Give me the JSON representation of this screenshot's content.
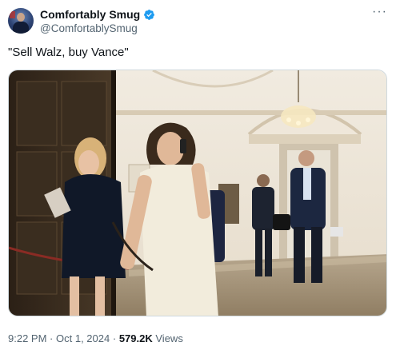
{
  "tweet": {
    "author": {
      "display_name": "Comfortably Smug",
      "handle": "@ComfortablySmug",
      "verified": true,
      "avatar_icon": "profile-avatar"
    },
    "more_icon": "more-horizontal-icon",
    "text": "\"Sell Walz, buy Vance\"",
    "media": {
      "type": "photo"
    },
    "timestamp": {
      "time": "9:22 PM",
      "separator": "·",
      "date": "Oct 1, 2024",
      "views_count": "579.2K",
      "views_label": "Views"
    },
    "colors": {
      "verified_badge": "#1d9bf0",
      "text_primary": "#0f1419",
      "text_secondary": "#536471"
    }
  }
}
